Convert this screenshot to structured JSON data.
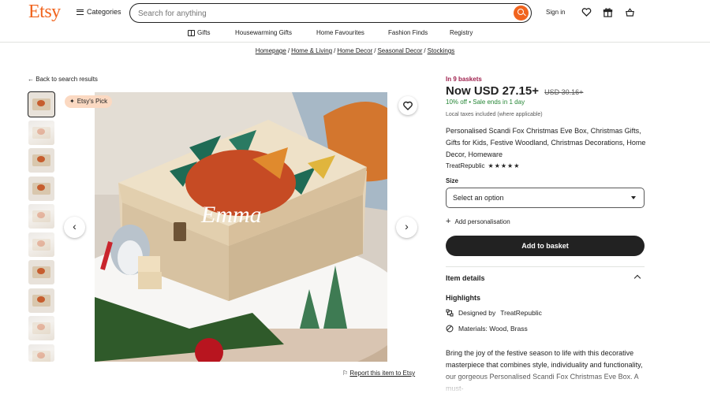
{
  "header": {
    "logo": "Etsy",
    "categories_label": "Categories",
    "search_placeholder": "Search for anything",
    "signin_label": "Sign in"
  },
  "nav": {
    "items": [
      "Gifts",
      "Housewarming Gifts",
      "Home Favourites",
      "Fashion Finds",
      "Registry"
    ]
  },
  "breadcrumb": [
    "Homepage",
    "Home & Living",
    "Home Decor",
    "Seasonal Decor",
    "Stockings"
  ],
  "back_link": "Back to search results",
  "gallery": {
    "badge": "Etsy's Pick",
    "report_link": "Report this item to Etsy",
    "box_name_text": "Emma",
    "thumbnail_count": 10
  },
  "listing": {
    "basket_count": "In 9 baskets",
    "price_now": "Now USD 27.15+",
    "price_original": "USD 30.16+",
    "discount_percent": "10% off",
    "sale_text": "Sale ends in 1 day",
    "taxes_note": "Local taxes included (where applicable)",
    "title": "Personalised Scandi Fox Christmas Eve Box, Christmas Gifts, Gifts for Kids, Festive Woodland, Christmas Decorations, Home Decor, Homeware",
    "shop_name": "TreatRepublic",
    "rating_stars": 5,
    "size_label": "Size",
    "size_placeholder": "Select an option",
    "add_personalisation": "Add personalisation",
    "add_to_basket": "Add to basket",
    "item_details_label": "Item details",
    "highlights_label": "Highlights",
    "designed_by_label": "Designed by",
    "designed_by_shop": "TreatRepublic",
    "materials": "Materials: Wood, Brass",
    "description": "Bring the joy of the festive season to life with this decorative masterpiece that combines style, individuality and functionality, our gorgeous Personalised Scandi Fox Christmas Eve Box. A must-"
  },
  "colors": {
    "brand": "#f1641e",
    "basket_count": "#9e1f4c",
    "discount": "#258635",
    "button": "#222222"
  }
}
